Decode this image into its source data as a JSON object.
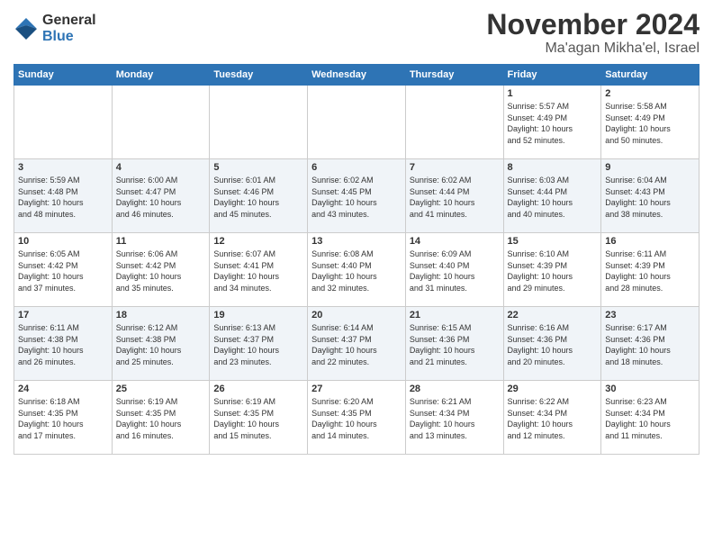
{
  "logo": {
    "general": "General",
    "blue": "Blue"
  },
  "title": "November 2024",
  "location": "Ma'agan Mikha'el, Israel",
  "headers": [
    "Sunday",
    "Monday",
    "Tuesday",
    "Wednesday",
    "Thursday",
    "Friday",
    "Saturday"
  ],
  "weeks": [
    [
      {
        "day": "",
        "info": ""
      },
      {
        "day": "",
        "info": ""
      },
      {
        "day": "",
        "info": ""
      },
      {
        "day": "",
        "info": ""
      },
      {
        "day": "",
        "info": ""
      },
      {
        "day": "1",
        "info": "Sunrise: 5:57 AM\nSunset: 4:49 PM\nDaylight: 10 hours\nand 52 minutes."
      },
      {
        "day": "2",
        "info": "Sunrise: 5:58 AM\nSunset: 4:49 PM\nDaylight: 10 hours\nand 50 minutes."
      }
    ],
    [
      {
        "day": "3",
        "info": "Sunrise: 5:59 AM\nSunset: 4:48 PM\nDaylight: 10 hours\nand 48 minutes."
      },
      {
        "day": "4",
        "info": "Sunrise: 6:00 AM\nSunset: 4:47 PM\nDaylight: 10 hours\nand 46 minutes."
      },
      {
        "day": "5",
        "info": "Sunrise: 6:01 AM\nSunset: 4:46 PM\nDaylight: 10 hours\nand 45 minutes."
      },
      {
        "day": "6",
        "info": "Sunrise: 6:02 AM\nSunset: 4:45 PM\nDaylight: 10 hours\nand 43 minutes."
      },
      {
        "day": "7",
        "info": "Sunrise: 6:02 AM\nSunset: 4:44 PM\nDaylight: 10 hours\nand 41 minutes."
      },
      {
        "day": "8",
        "info": "Sunrise: 6:03 AM\nSunset: 4:44 PM\nDaylight: 10 hours\nand 40 minutes."
      },
      {
        "day": "9",
        "info": "Sunrise: 6:04 AM\nSunset: 4:43 PM\nDaylight: 10 hours\nand 38 minutes."
      }
    ],
    [
      {
        "day": "10",
        "info": "Sunrise: 6:05 AM\nSunset: 4:42 PM\nDaylight: 10 hours\nand 37 minutes."
      },
      {
        "day": "11",
        "info": "Sunrise: 6:06 AM\nSunset: 4:42 PM\nDaylight: 10 hours\nand 35 minutes."
      },
      {
        "day": "12",
        "info": "Sunrise: 6:07 AM\nSunset: 4:41 PM\nDaylight: 10 hours\nand 34 minutes."
      },
      {
        "day": "13",
        "info": "Sunrise: 6:08 AM\nSunset: 4:40 PM\nDaylight: 10 hours\nand 32 minutes."
      },
      {
        "day": "14",
        "info": "Sunrise: 6:09 AM\nSunset: 4:40 PM\nDaylight: 10 hours\nand 31 minutes."
      },
      {
        "day": "15",
        "info": "Sunrise: 6:10 AM\nSunset: 4:39 PM\nDaylight: 10 hours\nand 29 minutes."
      },
      {
        "day": "16",
        "info": "Sunrise: 6:11 AM\nSunset: 4:39 PM\nDaylight: 10 hours\nand 28 minutes."
      }
    ],
    [
      {
        "day": "17",
        "info": "Sunrise: 6:11 AM\nSunset: 4:38 PM\nDaylight: 10 hours\nand 26 minutes."
      },
      {
        "day": "18",
        "info": "Sunrise: 6:12 AM\nSunset: 4:38 PM\nDaylight: 10 hours\nand 25 minutes."
      },
      {
        "day": "19",
        "info": "Sunrise: 6:13 AM\nSunset: 4:37 PM\nDaylight: 10 hours\nand 23 minutes."
      },
      {
        "day": "20",
        "info": "Sunrise: 6:14 AM\nSunset: 4:37 PM\nDaylight: 10 hours\nand 22 minutes."
      },
      {
        "day": "21",
        "info": "Sunrise: 6:15 AM\nSunset: 4:36 PM\nDaylight: 10 hours\nand 21 minutes."
      },
      {
        "day": "22",
        "info": "Sunrise: 6:16 AM\nSunset: 4:36 PM\nDaylight: 10 hours\nand 20 minutes."
      },
      {
        "day": "23",
        "info": "Sunrise: 6:17 AM\nSunset: 4:36 PM\nDaylight: 10 hours\nand 18 minutes."
      }
    ],
    [
      {
        "day": "24",
        "info": "Sunrise: 6:18 AM\nSunset: 4:35 PM\nDaylight: 10 hours\nand 17 minutes."
      },
      {
        "day": "25",
        "info": "Sunrise: 6:19 AM\nSunset: 4:35 PM\nDaylight: 10 hours\nand 16 minutes."
      },
      {
        "day": "26",
        "info": "Sunrise: 6:19 AM\nSunset: 4:35 PM\nDaylight: 10 hours\nand 15 minutes."
      },
      {
        "day": "27",
        "info": "Sunrise: 6:20 AM\nSunset: 4:35 PM\nDaylight: 10 hours\nand 14 minutes."
      },
      {
        "day": "28",
        "info": "Sunrise: 6:21 AM\nSunset: 4:34 PM\nDaylight: 10 hours\nand 13 minutes."
      },
      {
        "day": "29",
        "info": "Sunrise: 6:22 AM\nSunset: 4:34 PM\nDaylight: 10 hours\nand 12 minutes."
      },
      {
        "day": "30",
        "info": "Sunrise: 6:23 AM\nSunset: 4:34 PM\nDaylight: 10 hours\nand 11 minutes."
      }
    ]
  ]
}
